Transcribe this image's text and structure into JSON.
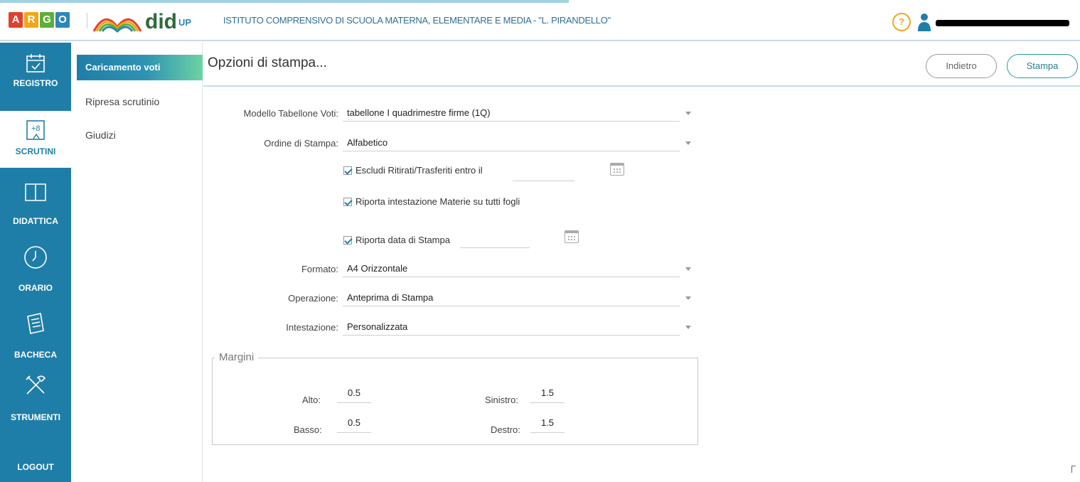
{
  "app": {
    "argo_letters": [
      "A",
      "R",
      "G",
      "O"
    ],
    "argo_colors": [
      "#e0402f",
      "#f0a818",
      "#5cb038",
      "#2f86b8"
    ],
    "product_name": "did",
    "product_suffix": "UP",
    "school_name": "ISTITUTO COMPRENSIVO DI SCUOLA MATERNA, ELEMENTARE E MEDIA - \"L. PIRANDELLO\"",
    "help_label": "?"
  },
  "sidebar": {
    "items": [
      {
        "label": "REGISTRO",
        "icon": "calendar-check-icon"
      },
      {
        "label": "SCRUTINI",
        "icon": "grades-icon"
      },
      {
        "label": "DIDATTICA",
        "icon": "book-icon"
      },
      {
        "label": "ORARIO",
        "icon": "clock-icon"
      },
      {
        "label": "BACHECA",
        "icon": "board-icon"
      },
      {
        "label": "STRUMENTI",
        "icon": "tools-icon"
      },
      {
        "label": "LOGOUT",
        "icon": ""
      }
    ],
    "grade_icon_text": "+8"
  },
  "submenu": {
    "items": [
      {
        "label": "Caricamento voti"
      },
      {
        "label": "Ripresa scrutinio"
      },
      {
        "label": "Giudizi"
      }
    ]
  },
  "toolbar": {
    "title": "Opzioni di stampa...",
    "back_label": "Indietro",
    "print_label": "Stampa"
  },
  "form": {
    "modello_label": "Modello Tabellone Voti:",
    "modello_value": "tabellone I quadrimestre firme (1Q)",
    "ordine_label": "Ordine di Stampa:",
    "ordine_value": "Alfabetico",
    "escludi_label": "Escludi Ritirati/Trasferiti entro il",
    "escludi_checked": true,
    "riporta_intest_label": "Riporta intestazione Materie su tutti fogli",
    "riporta_intest_checked": true,
    "riporta_data_label": "Riporta data di Stampa",
    "riporta_data_checked": true,
    "formato_label": "Formato:",
    "formato_value": "A4 Orizzontale",
    "operazione_label": "Operazione:",
    "operazione_value": "Anteprima di Stampa",
    "intestazione_label": "Intestazione:",
    "intestazione_value": "Personalizzata"
  },
  "margini": {
    "legend": "Margini",
    "alto_label": "Alto:",
    "alto_value": "0.5",
    "basso_label": "Basso:",
    "basso_value": "0.5",
    "sinistro_label": "Sinistro:",
    "sinistro_value": "1.5",
    "destro_label": "Destro:",
    "destro_value": "1.5"
  },
  "colors": {
    "sidebar": "#1f7ea8",
    "accent_green": "#6cd3a4",
    "help": "#f0a818"
  }
}
